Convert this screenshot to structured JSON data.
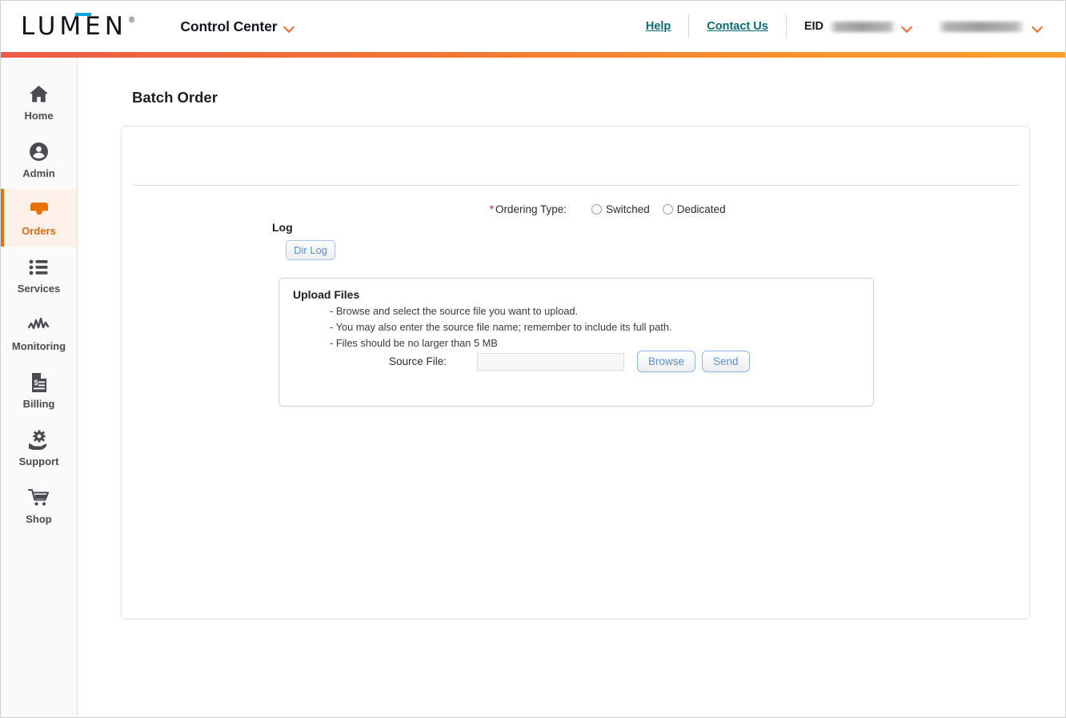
{
  "header": {
    "logo_text": "LUMEN",
    "logo_registered": "®",
    "app_title": "Control Center",
    "help_label": "Help",
    "contact_label": "Contact Us",
    "eid_label": "EID",
    "eid_value": "",
    "account_value": ""
  },
  "sidebar": {
    "items": [
      {
        "label": "Home",
        "icon": "home-icon",
        "active": false
      },
      {
        "label": "Admin",
        "icon": "user-circle-icon",
        "active": false
      },
      {
        "label": "Orders",
        "icon": "inbox-tray-icon",
        "active": true
      },
      {
        "label": "Services",
        "icon": "list-icon",
        "active": false
      },
      {
        "label": "Monitoring",
        "icon": "waveform-icon",
        "active": false
      },
      {
        "label": "Billing",
        "icon": "invoice-icon",
        "active": false
      },
      {
        "label": "Support",
        "icon": "gear-hand-icon",
        "active": false
      },
      {
        "label": "Shop",
        "icon": "cart-icon",
        "active": false
      }
    ]
  },
  "main": {
    "page_title": "Batch Order",
    "ordering_type": {
      "required_marker": "*",
      "label": "Ordering Type:",
      "options": [
        {
          "label": "Switched",
          "selected": false
        },
        {
          "label": "Dedicated",
          "selected": false
        }
      ]
    },
    "log": {
      "section_label": "Log",
      "dir_log_button": "Dir Log"
    },
    "upload": {
      "title": "Upload Files",
      "instructions": [
        "- Browse and select the source file you want to upload.",
        "- You may also enter the source file name; remember to include its full path.",
        "- Files should be no larger than 5 MB"
      ],
      "source_file_label": "Source File:",
      "source_file_value": "",
      "source_file_placeholder": "",
      "browse_button": "Browse",
      "send_button": "Send"
    }
  },
  "colors": {
    "brand_orange": "#e8700a",
    "gradient_start": "#ed5a47",
    "gradient_end": "#f9a02b",
    "link_teal": "#0a6b73",
    "button_blue": "#5b8fd0",
    "required_red": "#cf2020",
    "logo_accent_blue": "#0fa3e0"
  }
}
